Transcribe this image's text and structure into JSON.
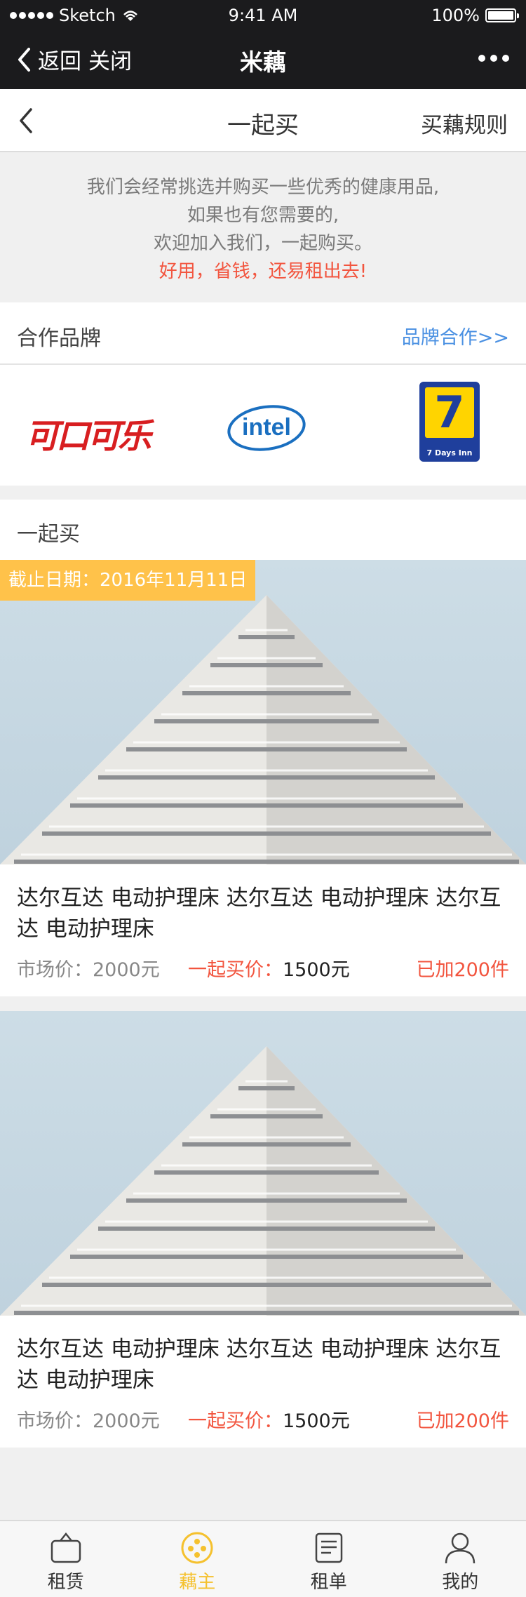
{
  "status_bar": {
    "carrier": "Sketch",
    "time": "9:41 AM",
    "battery": "100%"
  },
  "wechat_nav": {
    "back_label": "返回",
    "close_label": "关闭",
    "title": "米藕"
  },
  "page": {
    "title": "一起买",
    "rules_link": "买藕规则"
  },
  "intro": {
    "line1": "我们会经常挑选并购买一些优秀的健康用品,",
    "line2": "如果也有您需要的,",
    "line3": "欢迎加入我们，一起购买。",
    "highlight": "好用，省钱，还易租出去!"
  },
  "brands": {
    "heading": "合作品牌",
    "cooperate_link": "品牌合作>>",
    "logos": [
      {
        "name": "可口可乐"
      },
      {
        "name": "intel"
      },
      {
        "name": "7",
        "sub": "7 Days Inn"
      }
    ]
  },
  "buy_together": {
    "heading": "一起买",
    "products": [
      {
        "deadline": "截止日期：2016年11月11日",
        "name": "达尔互达 电动护理床 达尔互达 电动护理床 达尔互达 电动护理床",
        "market_price": "市场价：2000元",
        "group_price_label": "一起买价：",
        "group_price_value": "1500元",
        "joined": "已加200件"
      },
      {
        "deadline": "",
        "name": "达尔互达 电动护理床 达尔互达 电动护理床 达尔互达 电动护理床",
        "market_price": "市场价：2000元",
        "group_price_label": "一起买价：",
        "group_price_value": "1500元",
        "joined": "已加200件"
      }
    ]
  },
  "tabbar": {
    "items": [
      {
        "label": "租赁",
        "icon": "bag-icon",
        "active": false
      },
      {
        "label": "藕主",
        "icon": "lotus-icon",
        "active": true
      },
      {
        "label": "租单",
        "icon": "document-icon",
        "active": false
      },
      {
        "label": "我的",
        "icon": "person-icon",
        "active": false
      }
    ]
  },
  "colors": {
    "accent": "#f5c12e",
    "highlight_red": "#f2553f",
    "link_blue": "#4a90e2",
    "nav_bg": "#1b1b1d"
  }
}
